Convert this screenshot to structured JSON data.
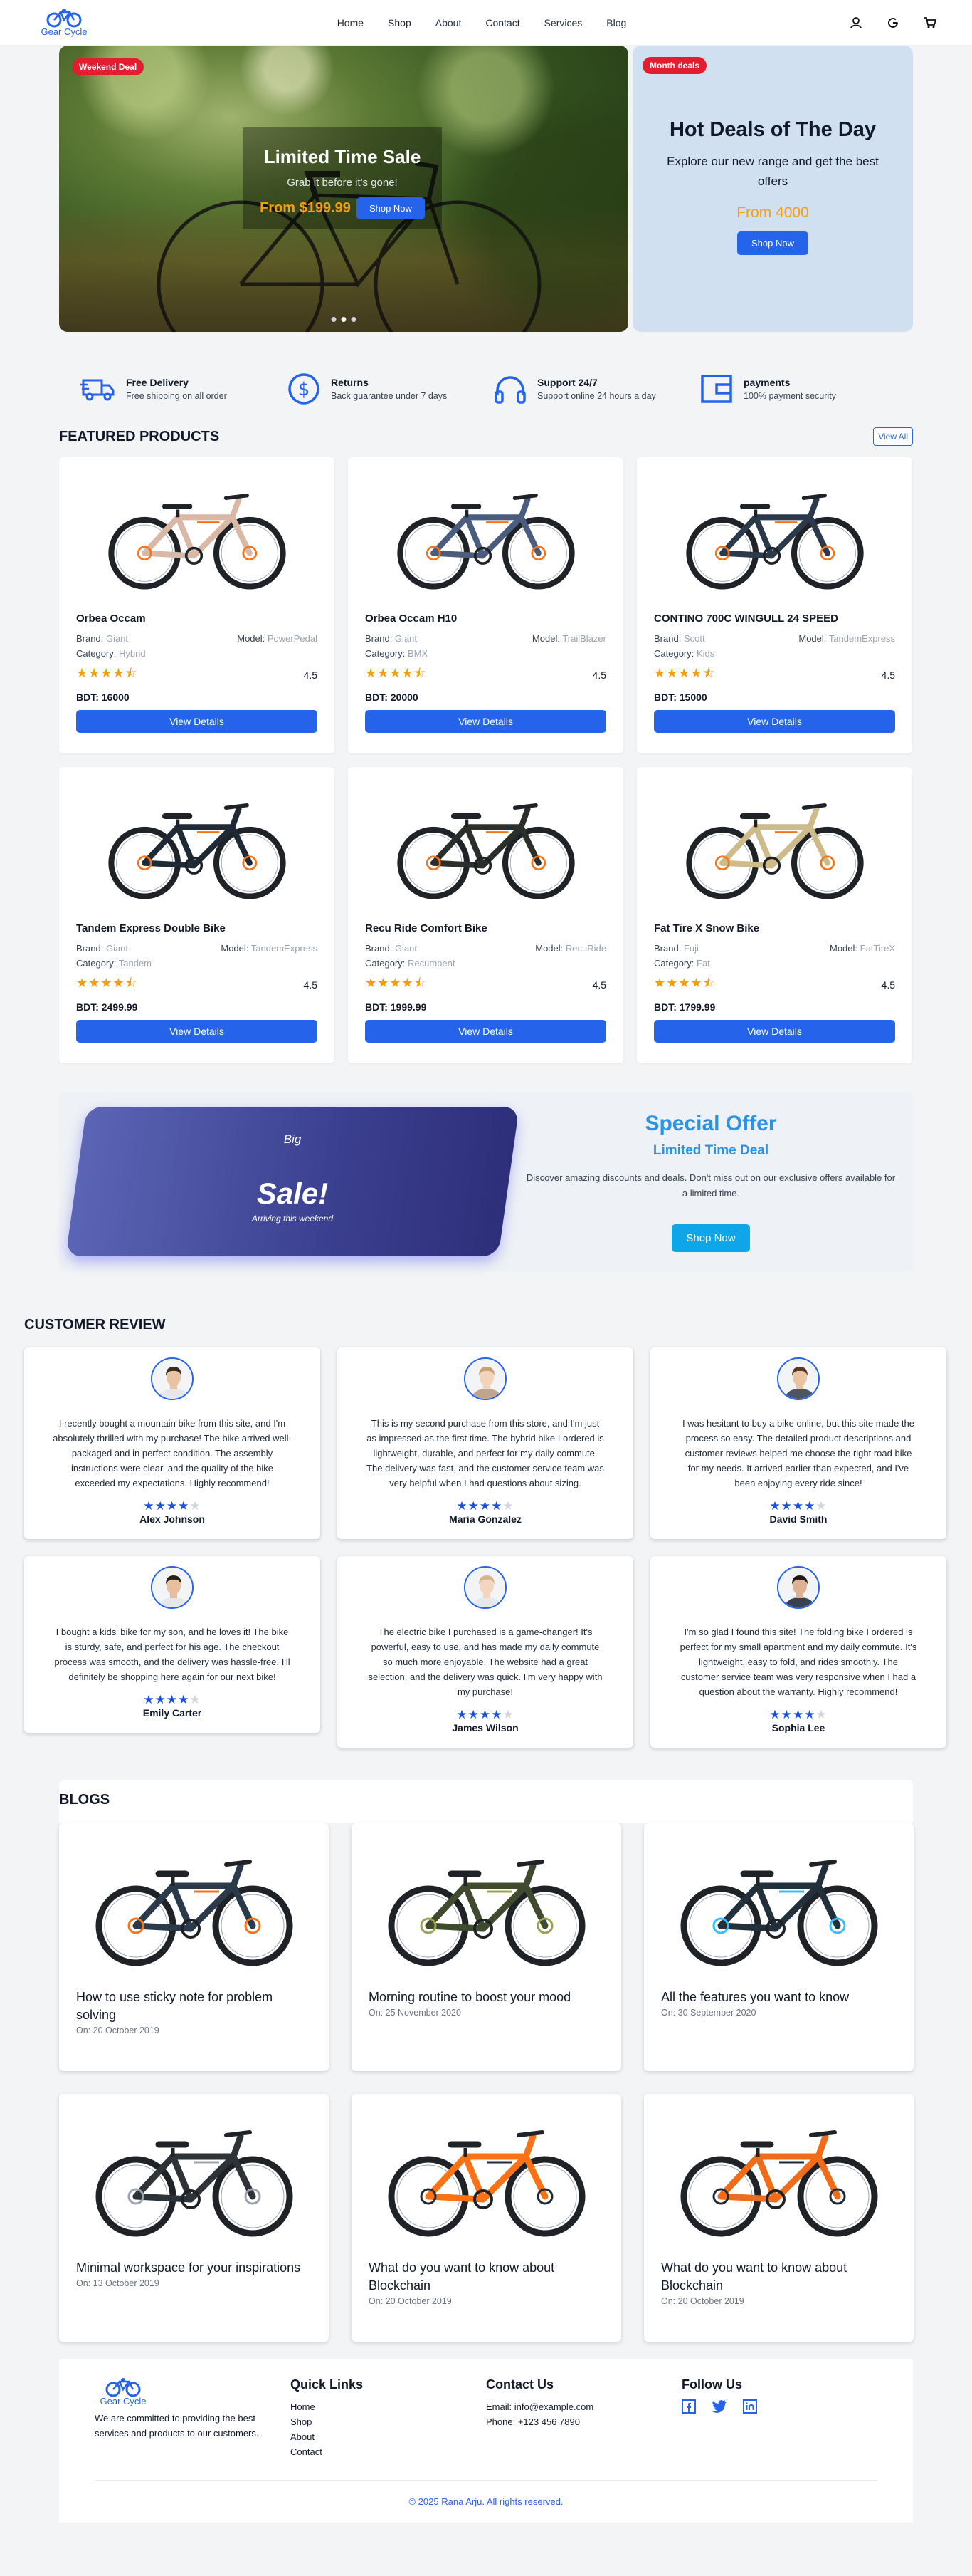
{
  "nav": {
    "logo_text": "Gear Cycle",
    "links": [
      "Home",
      "Shop",
      "About",
      "Contact",
      "Services",
      "Blog"
    ],
    "icons": [
      "user-icon",
      "google-icon",
      "cart-icon"
    ]
  },
  "hero": {
    "badge": "Weekend Deal",
    "title": "Limited Time Sale",
    "subtitle": "Grab it before it's gone!",
    "price": "From $199.99",
    "button": "Shop Now",
    "slides": 3,
    "active_slide": 2
  },
  "hero_side": {
    "badge": "Month deals",
    "title": "Hot Deals of The Day",
    "text": "Explore our new range and get the best offers",
    "price": "From 4000",
    "button": "Shop Now"
  },
  "features": [
    {
      "icon": "truck-icon",
      "title": "Free Delivery",
      "text": "Free shipping on all order"
    },
    {
      "icon": "dollar-icon",
      "title": "Returns",
      "text": "Back guarantee under 7 days"
    },
    {
      "icon": "headphones-icon",
      "title": "Support 24/7",
      "text": "Support online 24 hours a day"
    },
    {
      "icon": "wallet-icon",
      "title": "payments",
      "text": "100% payment security"
    }
  ],
  "featured": {
    "title": "FEATURED PRODUCTS",
    "view_all": "View All",
    "brand_label": "Brand:",
    "model_label": "Model:",
    "category_label": "Category:",
    "button": "View Details",
    "products": [
      {
        "name": "Orbea Occam",
        "brand": "Giant",
        "model": "PowerPedal",
        "category": "Hybrid",
        "rating": "4.5",
        "price": "BDT: 16000",
        "color": "#d9b8a6"
      },
      {
        "name": "Orbea Occam H10",
        "brand": "Giant",
        "model": "TrailBlazer",
        "category": "BMX",
        "rating": "4.5",
        "price": "BDT: 20000",
        "color": "#4b5d7e"
      },
      {
        "name": "CONTINO 700C WINGULL 24 SPEED",
        "brand": "Scott",
        "model": "TandemExpress",
        "category": "Kids",
        "rating": "4.5",
        "price": "BDT: 15000",
        "color": "#2a3a4a"
      },
      {
        "name": "Tandem Express Double Bike",
        "brand": "Giant",
        "model": "TandemExpress",
        "category": "Tandem",
        "rating": "4.5",
        "price": "BDT: 2499.99",
        "color": "#1f2a36"
      },
      {
        "name": "Recu Ride Comfort Bike",
        "brand": "Giant",
        "model": "RecuRide",
        "category": "Recumbent",
        "rating": "4.5",
        "price": "BDT: 1999.99",
        "color": "#2b2f2a"
      },
      {
        "name": "Fat Tire X Snow Bike",
        "brand": "Fuji",
        "model": "FatTireX",
        "category": "Fat",
        "rating": "4.5",
        "price": "BDT: 1799.99",
        "color": "#cdbb8a"
      }
    ]
  },
  "special": {
    "big": "Big",
    "sale": "Sale!",
    "arriving": "Arriving this weekend",
    "title": "Special Offer",
    "subtitle": "Limited Time Deal",
    "text": "Discover amazing discounts and deals. Don't miss out on our exclusive offers available for a limited time.",
    "button": "Shop Now"
  },
  "reviews": {
    "title": "CUSTOMER REVIEW",
    "items": [
      {
        "name": "Alex Johnson",
        "stars": 4,
        "text": "I recently bought a mountain bike from this site, and I'm absolutely thrilled with my purchase! The bike arrived well-packaged and in perfect condition. The assembly instructions were clear, and the quality of the bike exceeded my expectations. Highly recommend!",
        "hair": "#3a2a1e",
        "skin": "#e8c3a4",
        "shirt": "#e5e7eb"
      },
      {
        "name": "Maria Gonzalez",
        "stars": 4,
        "text": "This is my second purchase from this store, and I'm just as impressed as the first time. The hybrid bike I ordered is lightweight, durable, and perfect for my daily commute. The delivery was fast, and the customer service team was very helpful when I had questions about sizing.",
        "hair": "#c9a070",
        "skin": "#f1d4bb",
        "shirt": "#bfa58d"
      },
      {
        "name": "David Smith",
        "stars": 4,
        "text": "I was hesitant to buy a bike online, but this site made the process so easy. The detailed product descriptions and customer reviews helped me choose the right road bike for my needs. It arrived earlier than expected, and I've been enjoying every ride since!",
        "hair": "#5a3b23",
        "skin": "#e9c4a3",
        "shirt": "#4b5563"
      },
      {
        "name": "Emily Carter",
        "stars": 4,
        "text": "I bought a kids' bike for my son, and he loves it! The bike is sturdy, safe, and perfect for his age. The checkout process was smooth, and the delivery was hassle-free. I'll definitely be shopping here again for our next bike!",
        "hair": "#2b2119",
        "skin": "#e6bf9f",
        "shirt": "#e5e7eb"
      },
      {
        "name": "James Wilson",
        "stars": 4,
        "text": "The electric bike I purchased is a game-changer! It's powerful, easy to use, and has made my daily commute so much more enjoyable. The website had a great selection, and the delivery was quick. I'm very happy with my purchase!",
        "hair": "#d6b58a",
        "skin": "#f2d6bf",
        "shirt": "#e5e7eb"
      },
      {
        "name": "Sophia Lee",
        "stars": 4,
        "text": "I'm so glad I found this site! The folding bike I ordered is perfect for my small apartment and my daily commute. It's lightweight, easy to fold, and rides smoothly. The customer service team was very responsive when I had a question about the warranty. Highly recommend!",
        "hair": "#1f1a17",
        "skin": "#dcb194",
        "shirt": "#374151"
      }
    ]
  },
  "blogs": {
    "title": "BLOGS",
    "date_prefix": "On:",
    "items": [
      {
        "title": "How to use sticky note for problem solving",
        "date": "20 October 2019",
        "color": "#2a3a4a",
        "accent": "#f97316"
      },
      {
        "title": "Morning routine to boost your mood",
        "date": "25 November 2020",
        "color": "#3f4a2e",
        "accent": "#9ca34a"
      },
      {
        "title": "All the features you want to know",
        "date": "30 September 2020",
        "color": "#22303c",
        "accent": "#38bdf8"
      },
      {
        "title": "Minimal workspace for your inspirations",
        "date": "13 October 2019",
        "color": "#2e3338",
        "accent": "#9ca3af"
      },
      {
        "title": "What do you want to know about Blockchain",
        "date": "20 October 2019",
        "color": "#f97316",
        "accent": "#1f2937"
      },
      {
        "title": "What do you want to know about Blockchain",
        "date": "20 October 2019",
        "color": "#ef6c1a",
        "accent": "#1f2937"
      }
    ]
  },
  "footer": {
    "logo_text": "Gear Cycle",
    "about": "We are committed to providing the best services and products to our customers.",
    "quick_title": "Quick Links",
    "quick_links": [
      "Home",
      "Shop",
      "About",
      "Contact"
    ],
    "contact_title": "Contact Us",
    "email": "Email: info@example.com",
    "phone": "Phone: +123 456 7890",
    "follow_title": "Follow Us",
    "social": [
      "facebook-icon",
      "twitter-icon",
      "linkedin-icon"
    ],
    "copyright": "© 2025 Rana Arju. All rights reserved."
  },
  "colors": {
    "primary": "#2563eb",
    "badge": "#e11d2f",
    "price": "#f59e0b",
    "special": "#2a93e8"
  }
}
